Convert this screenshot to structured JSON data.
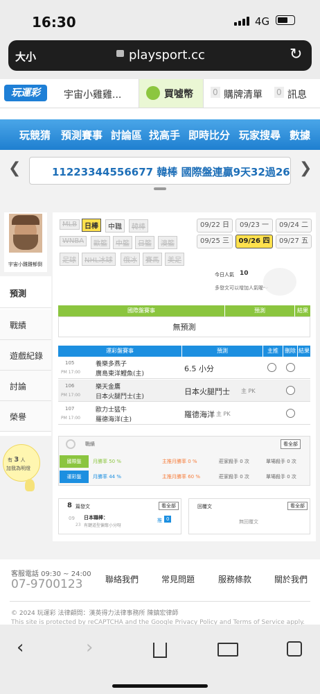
{
  "status_bar": {
    "time": "16:30",
    "network": "4G"
  },
  "browser": {
    "text_size": "大小",
    "url": "playsport.cc"
  },
  "topnav": {
    "logo": "玩運彩",
    "user": "宇宙小雞雞...",
    "buy": "買噓幣",
    "cart_count": "0",
    "cart": "購牌清單",
    "msg_count": "0",
    "msg": "訊息"
  },
  "banner": {
    "items": [
      "玩競猜",
      "預測賽事",
      "討論區",
      "找高手",
      "即時比分",
      "玩家搜尋",
      "數據"
    ]
  },
  "marquee": {
    "text": "11223344556677 韓棒 國際盤連贏9天32過26"
  },
  "profile": {
    "name": "宇宙小雞雞郁倒"
  },
  "sidebar": {
    "items": [
      "預測",
      "戰績",
      "遊戲紀錄",
      "討論",
      "榮譽"
    ],
    "likes_prefix": "有",
    "likes_count": "3",
    "likes_suffix": "人",
    "likes_line2": "加我為明燈"
  },
  "leagues": {
    "row1": [
      "MLB",
      "日棒",
      "中職",
      "韓棒"
    ],
    "row2": [
      "WNBA",
      "歐籃",
      "中籃",
      "日籃",
      "澳籃"
    ],
    "row3": [
      "足球",
      "NHL冰球",
      "俄冰",
      "賽馬",
      "美足"
    ]
  },
  "dates": [
    "09/22 日",
    "09/23 一",
    "09/24 二",
    "09/25 三",
    "09/26 四",
    "09/27 五"
  ],
  "popularity": {
    "label": "今日人氣",
    "value": "10",
    "note": "多發文可以增加人氣喔～"
  },
  "intl": {
    "header": [
      "國際盤賽事",
      "預測",
      "結果"
    ],
    "empty": "無預測"
  },
  "lottery": {
    "header": [
      "運彩盤賽事",
      "預測",
      "主推",
      "刪除",
      "結果"
    ],
    "rows": [
      {
        "no": "105",
        "time": "PM 17:00",
        "team1": "養樂多燕子",
        "team2": "廣島東洋鯉魚(主)",
        "pick": "6.5 小分",
        "sub": ""
      },
      {
        "no": "106",
        "time": "PM 17:00",
        "team1": "樂天金鷹",
        "team2": "日本火腿鬥士(主)",
        "pick": "日本火腿鬥士",
        "sub": "主 PK"
      },
      {
        "no": "107",
        "time": "PM 17:00",
        "team1": "歐力士猛牛",
        "team2": "羅德海洋(主)",
        "pick": "羅德海洋",
        "sub": "主 PK"
      }
    ]
  },
  "record": {
    "title": "戰績",
    "view_all": "看全部",
    "rows": [
      {
        "label": "國際盤",
        "win": "月勝率 50 %",
        "main": "主推月勝率 0 %",
        "kill": "莊家殺手 0 次",
        "single": "單場殺手 0 次"
      },
      {
        "label": "運彩盤",
        "win": "月勝率 44 %",
        "main": "主推月勝率 60 %",
        "kill": "莊家殺手 0 次",
        "single": "單場殺手 0 次"
      }
    ]
  },
  "posts": {
    "count": "8",
    "label": "篇發文",
    "view_all": "看全部",
    "date_m": "09",
    "date_d": "23",
    "title": "日本職棒：",
    "sub": "有鍵道型偏奪小分呀",
    "push": "推",
    "push_count": "0"
  },
  "replies": {
    "label": "回覆文",
    "view_all": "看全部",
    "empty": "無回覆文"
  },
  "footer": {
    "service_label": "客服電話 09:30 ~ 24:00",
    "phone": "07-9700123",
    "links": [
      "聯絡我們",
      "常見問題",
      "服務條款",
      "關於我們"
    ],
    "copyright": "© 2024 玩運彩 法律顧問：漢英得力法律事務所 陳鎮宏律師",
    "captcha": "This site is protected by reCAPTCHA and the Google Privacy Policy and Terms of Service apply."
  }
}
